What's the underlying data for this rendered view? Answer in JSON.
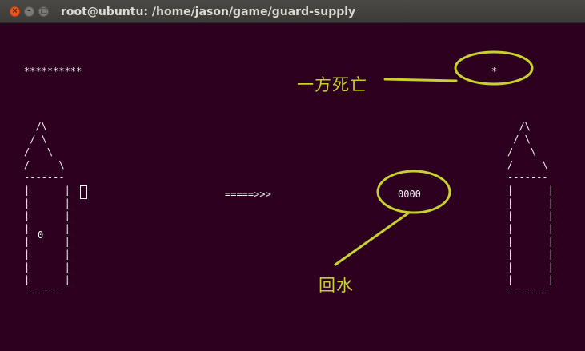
{
  "window": {
    "title": "root@ubuntu: /home/jason/game/guard-supply",
    "buttons": {
      "close": "×",
      "minimize": "–",
      "maximize": "□"
    }
  },
  "terminal": {
    "health_stars": "**********",
    "enemy_health": "*",
    "left_tower": " /\\\n / \\\n/   \\\n/     \\\n-------\n|      |\n|      |\n|      |\n| 0    |\n|      |\n|      |\n|      |\n|      |\n-------",
    "right_tower": "  /\\\n / \\\n/   \\\n/     \\\n-------\n|      |\n|      |\n|      |\n|      |\n|      |\n|      |\n|      |\n|      |\n-------",
    "player_marker": "0",
    "arrow": "=====>>>",
    "water_supply": "0000"
  },
  "annotations": {
    "death_label": "一方死亡",
    "water_label": "回水",
    "color": "#c8d22c"
  }
}
